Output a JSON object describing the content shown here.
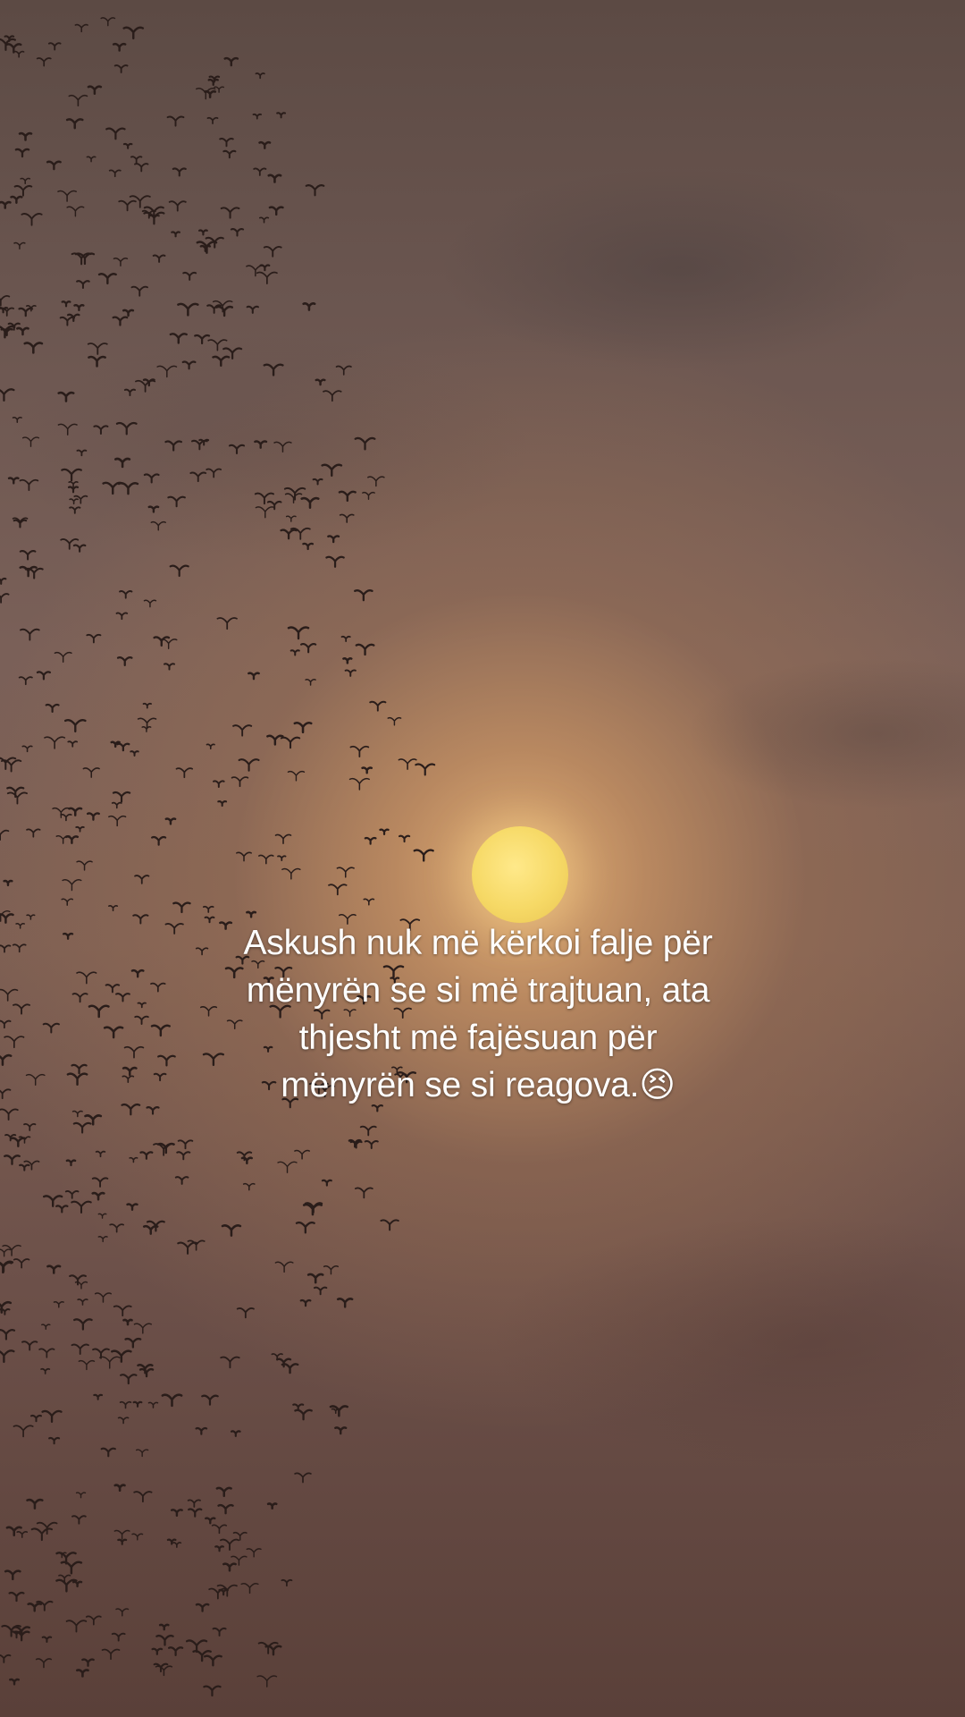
{
  "caption": {
    "text": "Askush nuk më kërkoi falje për mënyrën se si më trajtuan, ata thjesht më fajësuan për mënyrën se si reagova.😣"
  },
  "scene": {
    "moon_color": "#f6d966",
    "bird_color": "#2a1d1a",
    "sky_color": "#7a6058"
  }
}
